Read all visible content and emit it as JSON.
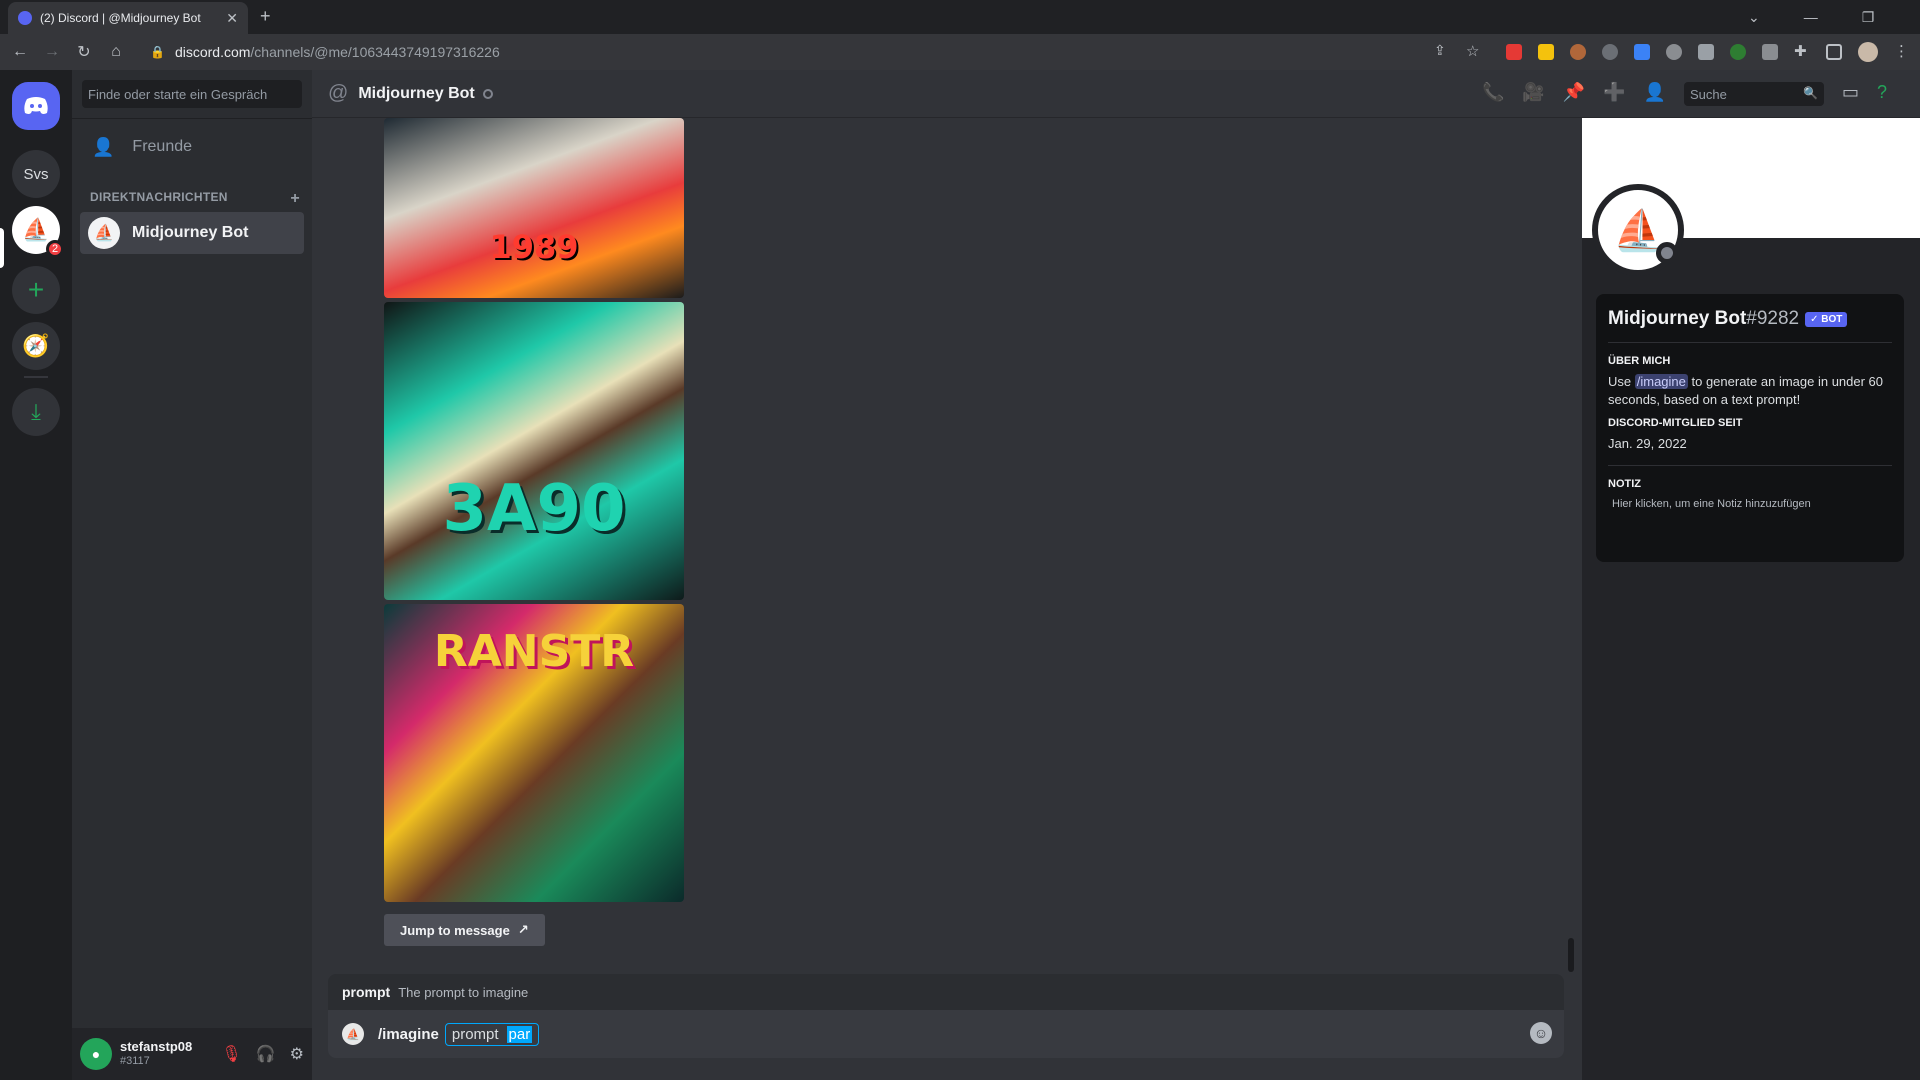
{
  "browser": {
    "tab_title": "(2) Discord | @Midjourney Bot",
    "url_host": "discord.com",
    "url_path": "/channels/@me/1063443749197316226"
  },
  "servers": {
    "svs_label": "Svs",
    "badge_count": "2"
  },
  "dm": {
    "search_placeholder": "Finde oder starte ein Gespräch",
    "friends_label": "Freunde",
    "section_label": "DIREKTNACHRICHTEN",
    "items": [
      {
        "label": "Midjourney Bot"
      }
    ]
  },
  "user": {
    "name": "stefanstp08",
    "tag": "#3117"
  },
  "channel": {
    "title": "Midjourney Bot",
    "search_placeholder": "Suche"
  },
  "messages": {
    "image_texts": [
      "1989",
      "3A90",
      "RANSTR"
    ],
    "jump_label": "Jump to message"
  },
  "composer": {
    "option_name": "prompt",
    "option_desc": "The prompt to imagine",
    "command": "/imagine",
    "param_label": "prompt",
    "typed_value": "par"
  },
  "profile": {
    "name": "Midjourney Bot",
    "discriminator": "#9282",
    "bot_badge": "✓ BOT",
    "about_label": "ÜBER MICH",
    "about_before": "Use ",
    "about_cmd": "/imagine",
    "about_after": " to generate an image in under 60 seconds, based on a text prompt!",
    "member_since_label": "DISCORD-MITGLIED SEIT",
    "member_since": "Jan. 29, 2022",
    "note_label": "NOTIZ",
    "note_placeholder": "Hier klicken, um eine Notiz hinzuzufügen"
  },
  "colors": {
    "blurple": "#5865f2",
    "online_green": "#23a55a",
    "focus_blue": "#00a8fc"
  }
}
